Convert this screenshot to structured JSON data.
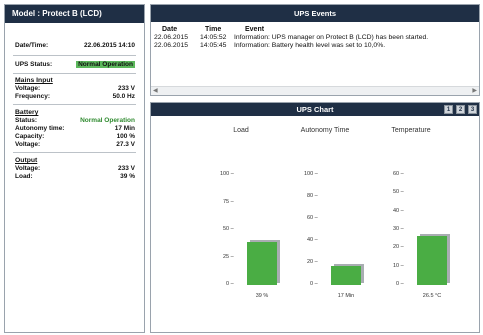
{
  "left_panel": {
    "model_header": "Model : Protect B (LCD)",
    "datetime_label": "Date/Time:",
    "datetime_value": "22.06.2015 14:10",
    "ups_status_label": "UPS Status:",
    "ups_status_value": "Normal Operation",
    "mains_title": "Mains Input",
    "mains": [
      {
        "label": "Voltage:",
        "value": "233 V"
      },
      {
        "label": "Frequency:",
        "value": "50.0 Hz"
      }
    ],
    "battery_title": "Battery",
    "battery": [
      {
        "label": "Status:",
        "value": "Normal Operation"
      },
      {
        "label": "Autonomy time:",
        "value": "17 Min"
      },
      {
        "label": "Capacity:",
        "value": "100 %"
      },
      {
        "label": "Voltage:",
        "value": "27.3 V"
      }
    ],
    "output_title": "Output",
    "output": [
      {
        "label": "Voltage:",
        "value": "233 V"
      },
      {
        "label": "Load:",
        "value": "39 %"
      }
    ]
  },
  "events": {
    "title": "UPS Events",
    "columns": [
      "Date",
      "Time",
      "Event"
    ],
    "rows": [
      {
        "date": "22.06.2015",
        "time": "14:05:52",
        "event": "Information: UPS manager on Protect B (LCD) has been started."
      },
      {
        "date": "22.06.2015",
        "time": "14:05:45",
        "event": "Information: Battery health level was set to 10,0%."
      }
    ]
  },
  "chart": {
    "title": "UPS Chart",
    "pages": [
      "1",
      "2",
      "3"
    ]
  },
  "colors": {
    "header_bg": "#1f2f45",
    "bar": "#4aad44",
    "status_ok": "#5cb85c"
  },
  "chart_data": [
    {
      "type": "bar",
      "title": "Load",
      "categories": [
        ""
      ],
      "values": [
        39
      ],
      "ylim": [
        0,
        100
      ],
      "ticks": [
        0,
        25,
        50,
        75,
        100
      ],
      "value_label": "39 %"
    },
    {
      "type": "bar",
      "title": "Autonomy Time",
      "categories": [
        ""
      ],
      "values": [
        17
      ],
      "ylim": [
        0,
        100
      ],
      "ticks": [
        0,
        20,
        40,
        60,
        80,
        100
      ],
      "value_label": "17 Min"
    },
    {
      "type": "bar",
      "title": "Temperature",
      "categories": [
        ""
      ],
      "values": [
        26.5
      ],
      "ylim": [
        0,
        60
      ],
      "ticks": [
        0,
        10,
        20,
        30,
        40,
        50,
        60
      ],
      "value_label": "26.5 °C"
    }
  ]
}
